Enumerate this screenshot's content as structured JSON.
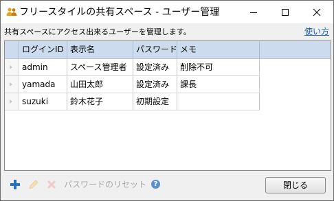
{
  "window": {
    "title": "フリースタイルの共有スペース - ユーザー管理",
    "minimize_icon": "minimize-icon",
    "maximize_icon": "maximize-icon",
    "close_icon": "close-icon"
  },
  "header": {
    "description": "共有スペースにアクセス出来るユーザーを管理します。",
    "help_link": "使い方"
  },
  "table": {
    "columns": [
      "ログインID",
      "表示名",
      "パスワード",
      "メモ"
    ],
    "rows": [
      [
        "admin",
        "スペース管理者",
        "設定済み",
        "削除不可"
      ],
      [
        "yamada",
        "山田太郎",
        "設定済み",
        "課長"
      ],
      [
        "suzuki",
        "鈴木花子",
        "初期設定",
        ""
      ]
    ]
  },
  "toolbar": {
    "add_icon": "plus-icon",
    "edit_icon": "pencil-icon",
    "delete_icon": "x-icon",
    "reset_password_label": "パスワードのリセット",
    "help_icon": "question-icon",
    "close_button": "閉じる"
  },
  "colors": {
    "header_bg": "#ccdcee",
    "accent": "#2b6cc4",
    "link": "#1a5fb4"
  }
}
